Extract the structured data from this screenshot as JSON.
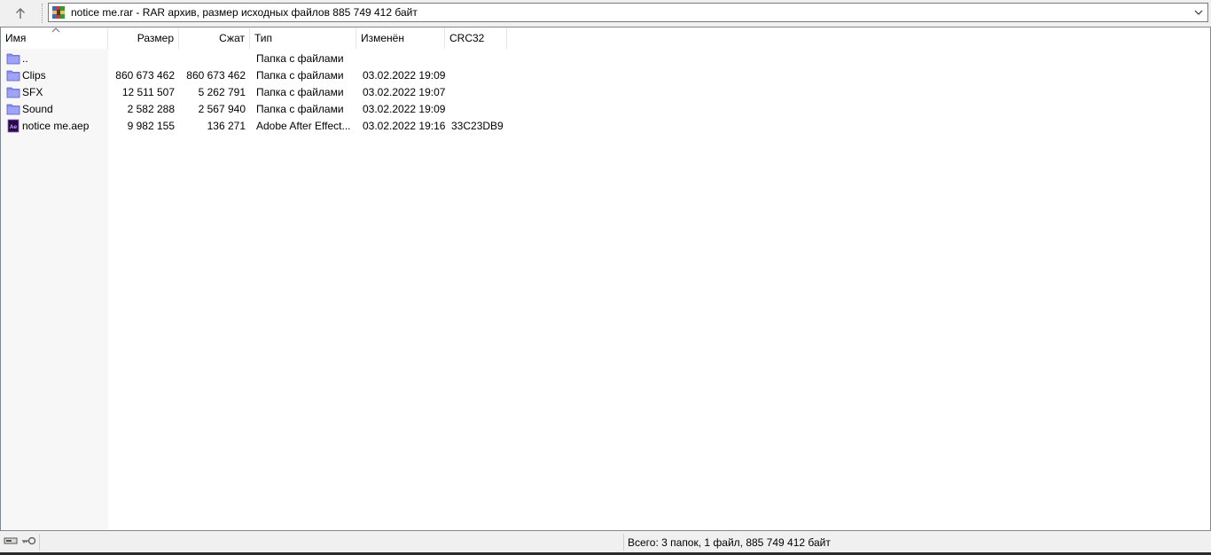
{
  "address_bar": {
    "text": "notice me.rar - RAR архив, размер исходных файлов 885 749 412 байт",
    "icon": "winrar-archive-icon"
  },
  "columns": [
    {
      "key": "name",
      "label": "Имя"
    },
    {
      "key": "size",
      "label": "Размер"
    },
    {
      "key": "packed",
      "label": "Сжат"
    },
    {
      "key": "type",
      "label": "Тип"
    },
    {
      "key": "modified",
      "label": "Изменён"
    },
    {
      "key": "crc",
      "label": "CRC32"
    }
  ],
  "files": [
    {
      "name": "..",
      "size": "",
      "packed": "",
      "type": "Папка с файлами",
      "modified": "",
      "crc": "",
      "icon": "folder-icon"
    },
    {
      "name": "Clips",
      "size": "860 673 462",
      "packed": "860 673 462",
      "type": "Папка с файлами",
      "modified": "03.02.2022 19:09",
      "crc": "",
      "icon": "folder-icon"
    },
    {
      "name": "SFX",
      "size": "12 511 507",
      "packed": "5 262 791",
      "type": "Папка с файлами",
      "modified": "03.02.2022 19:07",
      "crc": "",
      "icon": "folder-icon"
    },
    {
      "name": "Sound",
      "size": "2 582 288",
      "packed": "2 567 940",
      "type": "Папка с файлами",
      "modified": "03.02.2022 19:09",
      "crc": "",
      "icon": "folder-icon"
    },
    {
      "name": "notice me.aep",
      "size": "9 982 155",
      "packed": "136 271",
      "type": "Adobe After Effect...",
      "modified": "03.02.2022 19:16",
      "crc": "33C23DB9",
      "icon": "after-effects-file-icon"
    }
  ],
  "status_bar": {
    "summary": "Всего: 3 папок, 1 файл, 885 749 412 байт"
  },
  "colors": {
    "folder": "#8b8ff0",
    "ae_purple": "#2a0b4a",
    "ae_accent": "#c9a3ff"
  }
}
